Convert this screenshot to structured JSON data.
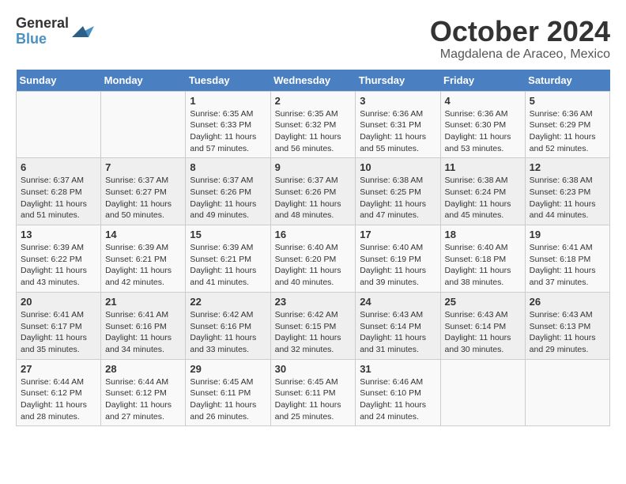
{
  "logo": {
    "general": "General",
    "blue": "Blue"
  },
  "title": "October 2024",
  "location": "Magdalena de Araceo, Mexico",
  "days_of_week": [
    "Sunday",
    "Monday",
    "Tuesday",
    "Wednesday",
    "Thursday",
    "Friday",
    "Saturday"
  ],
  "weeks": [
    [
      {
        "day": "",
        "info": ""
      },
      {
        "day": "",
        "info": ""
      },
      {
        "day": "1",
        "info": "Sunrise: 6:35 AM\nSunset: 6:33 PM\nDaylight: 11 hours and 57 minutes."
      },
      {
        "day": "2",
        "info": "Sunrise: 6:35 AM\nSunset: 6:32 PM\nDaylight: 11 hours and 56 minutes."
      },
      {
        "day": "3",
        "info": "Sunrise: 6:36 AM\nSunset: 6:31 PM\nDaylight: 11 hours and 55 minutes."
      },
      {
        "day": "4",
        "info": "Sunrise: 6:36 AM\nSunset: 6:30 PM\nDaylight: 11 hours and 53 minutes."
      },
      {
        "day": "5",
        "info": "Sunrise: 6:36 AM\nSunset: 6:29 PM\nDaylight: 11 hours and 52 minutes."
      }
    ],
    [
      {
        "day": "6",
        "info": "Sunrise: 6:37 AM\nSunset: 6:28 PM\nDaylight: 11 hours and 51 minutes."
      },
      {
        "day": "7",
        "info": "Sunrise: 6:37 AM\nSunset: 6:27 PM\nDaylight: 11 hours and 50 minutes."
      },
      {
        "day": "8",
        "info": "Sunrise: 6:37 AM\nSunset: 6:26 PM\nDaylight: 11 hours and 49 minutes."
      },
      {
        "day": "9",
        "info": "Sunrise: 6:37 AM\nSunset: 6:26 PM\nDaylight: 11 hours and 48 minutes."
      },
      {
        "day": "10",
        "info": "Sunrise: 6:38 AM\nSunset: 6:25 PM\nDaylight: 11 hours and 47 minutes."
      },
      {
        "day": "11",
        "info": "Sunrise: 6:38 AM\nSunset: 6:24 PM\nDaylight: 11 hours and 45 minutes."
      },
      {
        "day": "12",
        "info": "Sunrise: 6:38 AM\nSunset: 6:23 PM\nDaylight: 11 hours and 44 minutes."
      }
    ],
    [
      {
        "day": "13",
        "info": "Sunrise: 6:39 AM\nSunset: 6:22 PM\nDaylight: 11 hours and 43 minutes."
      },
      {
        "day": "14",
        "info": "Sunrise: 6:39 AM\nSunset: 6:21 PM\nDaylight: 11 hours and 42 minutes."
      },
      {
        "day": "15",
        "info": "Sunrise: 6:39 AM\nSunset: 6:21 PM\nDaylight: 11 hours and 41 minutes."
      },
      {
        "day": "16",
        "info": "Sunrise: 6:40 AM\nSunset: 6:20 PM\nDaylight: 11 hours and 40 minutes."
      },
      {
        "day": "17",
        "info": "Sunrise: 6:40 AM\nSunset: 6:19 PM\nDaylight: 11 hours and 39 minutes."
      },
      {
        "day": "18",
        "info": "Sunrise: 6:40 AM\nSunset: 6:18 PM\nDaylight: 11 hours and 38 minutes."
      },
      {
        "day": "19",
        "info": "Sunrise: 6:41 AM\nSunset: 6:18 PM\nDaylight: 11 hours and 37 minutes."
      }
    ],
    [
      {
        "day": "20",
        "info": "Sunrise: 6:41 AM\nSunset: 6:17 PM\nDaylight: 11 hours and 35 minutes."
      },
      {
        "day": "21",
        "info": "Sunrise: 6:41 AM\nSunset: 6:16 PM\nDaylight: 11 hours and 34 minutes."
      },
      {
        "day": "22",
        "info": "Sunrise: 6:42 AM\nSunset: 6:16 PM\nDaylight: 11 hours and 33 minutes."
      },
      {
        "day": "23",
        "info": "Sunrise: 6:42 AM\nSunset: 6:15 PM\nDaylight: 11 hours and 32 minutes."
      },
      {
        "day": "24",
        "info": "Sunrise: 6:43 AM\nSunset: 6:14 PM\nDaylight: 11 hours and 31 minutes."
      },
      {
        "day": "25",
        "info": "Sunrise: 6:43 AM\nSunset: 6:14 PM\nDaylight: 11 hours and 30 minutes."
      },
      {
        "day": "26",
        "info": "Sunrise: 6:43 AM\nSunset: 6:13 PM\nDaylight: 11 hours and 29 minutes."
      }
    ],
    [
      {
        "day": "27",
        "info": "Sunrise: 6:44 AM\nSunset: 6:12 PM\nDaylight: 11 hours and 28 minutes."
      },
      {
        "day": "28",
        "info": "Sunrise: 6:44 AM\nSunset: 6:12 PM\nDaylight: 11 hours and 27 minutes."
      },
      {
        "day": "29",
        "info": "Sunrise: 6:45 AM\nSunset: 6:11 PM\nDaylight: 11 hours and 26 minutes."
      },
      {
        "day": "30",
        "info": "Sunrise: 6:45 AM\nSunset: 6:11 PM\nDaylight: 11 hours and 25 minutes."
      },
      {
        "day": "31",
        "info": "Sunrise: 6:46 AM\nSunset: 6:10 PM\nDaylight: 11 hours and 24 minutes."
      },
      {
        "day": "",
        "info": ""
      },
      {
        "day": "",
        "info": ""
      }
    ]
  ]
}
